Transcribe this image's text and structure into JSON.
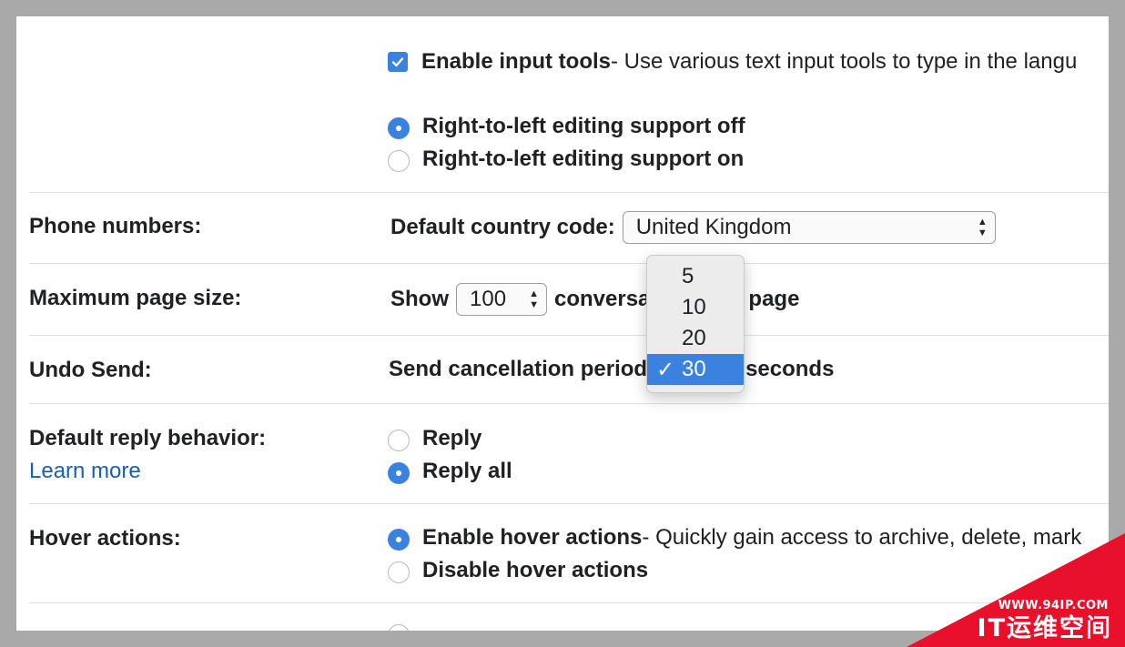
{
  "input_tools": {
    "checked": true,
    "label": "Enable input tools",
    "description": " - Use various text input tools to type in the langu"
  },
  "rtl": {
    "options": [
      {
        "label": "Right-to-left editing support off",
        "selected": true
      },
      {
        "label": "Right-to-left editing support on",
        "selected": false
      }
    ]
  },
  "phone_numbers": {
    "label": "Phone numbers:",
    "field_label": "Default country code:",
    "selected": "United Kingdom"
  },
  "page_size": {
    "label": "Maximum page size:",
    "prefix": "Show",
    "selected": "100",
    "suffix_visible_1": "conversa",
    "suffix_visible_2": "page"
  },
  "undo_send": {
    "label": "Undo Send:",
    "field_label": "Send cancellation period",
    "suffix": "seconds",
    "dropdown_options": [
      "5",
      "10",
      "20",
      "30"
    ],
    "selected": "30"
  },
  "reply_behavior": {
    "label": "Default reply behavior:",
    "learn_more": "Learn more",
    "options": [
      {
        "label": "Reply",
        "selected": false
      },
      {
        "label": "Reply all",
        "selected": true
      }
    ]
  },
  "hover_actions": {
    "label": "Hover actions:",
    "enable_label": "Enable hover actions",
    "enable_description": " - Quickly gain access to archive, delete, mark",
    "disable_label": "Disable hover actions",
    "enable_selected": true
  },
  "watermark": {
    "url": "WWW.94IP.COM",
    "name": "IT运维空间",
    "color": "#e8102a"
  },
  "colors": {
    "accent": "#3b82e0",
    "link": "#1a5fb4",
    "background": "#a9a9a9"
  }
}
